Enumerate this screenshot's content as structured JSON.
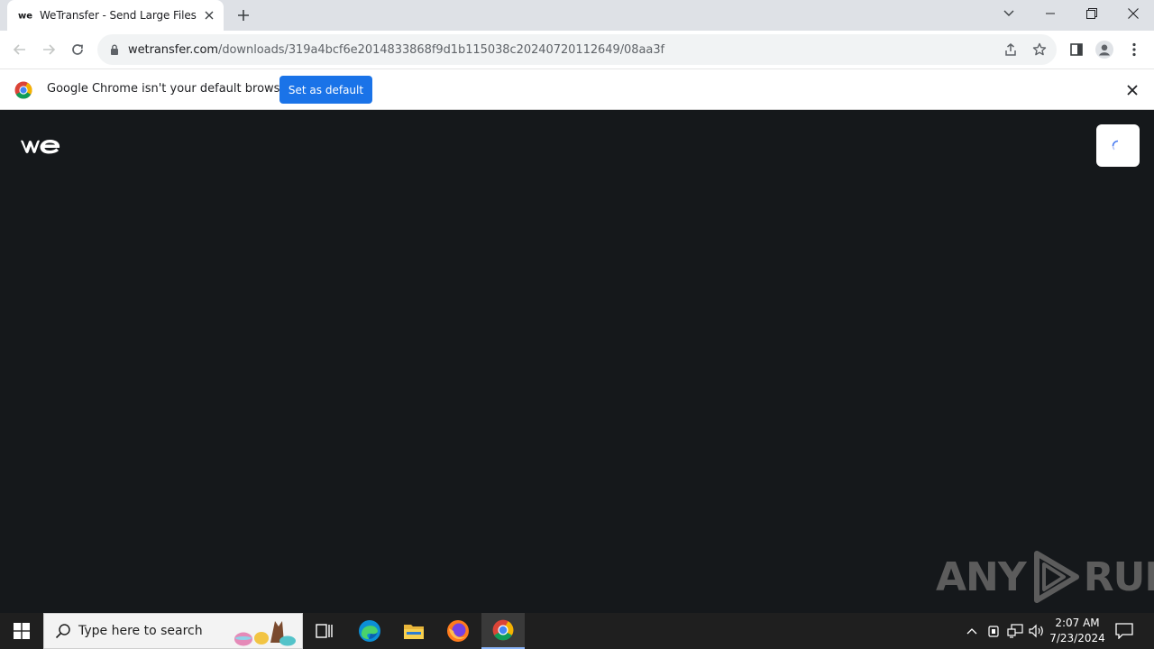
{
  "browser": {
    "tab": {
      "title": "WeTransfer - Send Large Files & S",
      "favicon": "wetransfer-logo"
    },
    "new_tab_icon": "plus-icon",
    "window_controls": [
      "chevron-down-icon",
      "minimize-icon",
      "restore-icon",
      "close-icon"
    ],
    "toolbar": {
      "url_host": "wetransfer.com",
      "url_path": "/downloads/319a4bcf6e2014833868f9d1b115038c20240720112649/08aa3f"
    },
    "infobar": {
      "message": "Google Chrome isn't your default browser",
      "button_label": "Set as default"
    }
  },
  "page": {
    "logo": "wetransfer-we-logo",
    "state": "loading",
    "watermark": {
      "left": "ANY",
      "right": "RUN"
    }
  },
  "taskbar": {
    "search_placeholder": "Type here to search",
    "apps": [
      "task-view-icon",
      "edge-icon",
      "file-explorer-icon",
      "firefox-icon",
      "chrome-icon"
    ],
    "active_app": "chrome-icon",
    "clock": {
      "time": "2:07 AM",
      "date": "7/23/2024"
    }
  },
  "colors": {
    "page_bg": "#15181b",
    "accent_button": "#1a73e8",
    "tabstrip_bg": "#dee1e6",
    "taskbar_bg": "#1f1f1f"
  }
}
